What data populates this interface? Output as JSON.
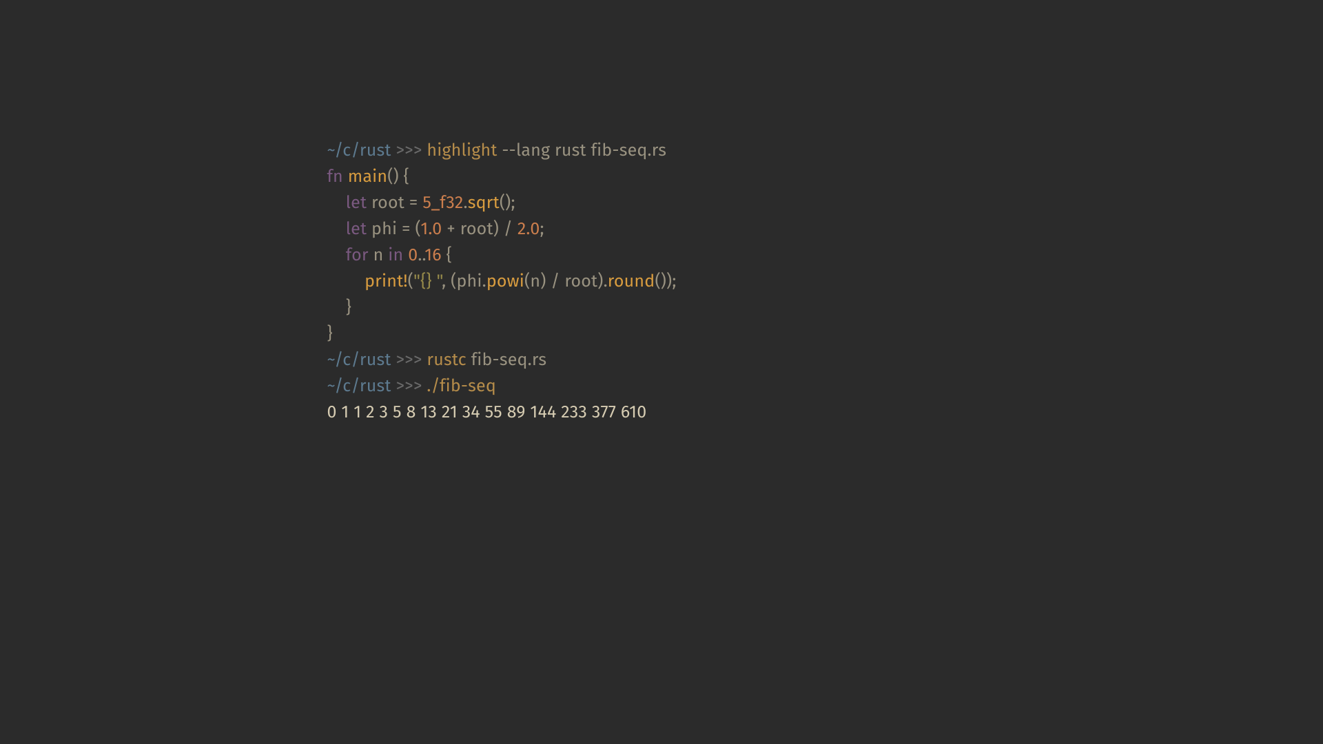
{
  "prompt": {
    "dir": "~/c/rust",
    "marker": ">>>"
  },
  "commands": {
    "highlight": {
      "cmd": "highlight",
      "args": " --lang rust fib-seq.rs"
    },
    "rustc": {
      "cmd": "rustc",
      "args": " fib-seq.rs"
    },
    "run": {
      "cmd": "./fib-seq",
      "args": ""
    }
  },
  "code": {
    "l1": {
      "kw_fn": "fn ",
      "name": "main",
      "after": "() {"
    },
    "l2": {
      "indent": "    ",
      "kw_let": "let",
      "sp": " ",
      "var": "root = ",
      "num": "5_f32",
      "dot": ".",
      "method": "sqrt",
      "after": "();"
    },
    "l3": {
      "indent": "    ",
      "kw_let": "let",
      "sp": " ",
      "var": "phi = (",
      "num1": "1.0",
      "plus": " + root) / ",
      "num2": "2.0",
      "end": ";"
    },
    "l4": {
      "indent": "    ",
      "kw_for": "for",
      "sp1": " ",
      "var": "n ",
      "kw_in": "in",
      "sp2": " ",
      "n1": "0",
      "dots": "..",
      "n2": "16",
      "brace": " {"
    },
    "l5": {
      "indent": "        ",
      "print": "print!",
      "open": "(",
      "str": "\"{} \"",
      "mid": ", (phi.",
      "m1": "powi",
      "args": "(n) / root).",
      "m2": "round",
      "end": "());"
    },
    "l6": {
      "indent": "    ",
      "brace": "}"
    },
    "l7": {
      "brace": "}"
    }
  },
  "output": "0 1 1 2 3 5 8 13 21 34 55 89 144 233 377 610 "
}
